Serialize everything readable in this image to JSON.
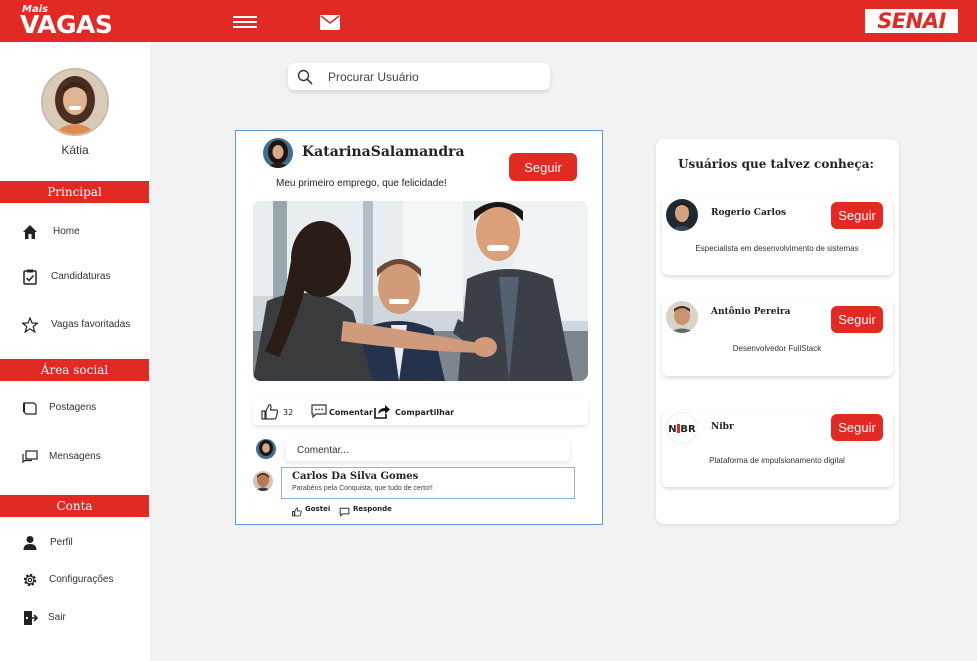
{
  "header": {
    "logo_small": "Mais",
    "logo_big": "VAGAS",
    "brand": "SENAI",
    "menu_icon": "hamburger-icon",
    "mail_icon": "mail-icon"
  },
  "sidebar": {
    "user_name": "Kátia",
    "sections": [
      "Principal",
      "Área social",
      "Conta"
    ],
    "principal": [
      {
        "label": "Home",
        "icon": "home-icon"
      },
      {
        "label": "Candidaturas",
        "icon": "clipboard-check-icon"
      },
      {
        "label": "Vagas favoritadas",
        "icon": "star-icon"
      }
    ],
    "social": [
      {
        "label": "Postagens",
        "icon": "postagens-icon"
      },
      {
        "label": "Mensagens",
        "icon": "messages-icon"
      }
    ],
    "conta": [
      {
        "label": "Perfil",
        "icon": "person-icon"
      },
      {
        "label": "Configurações",
        "icon": "gear-icon"
      },
      {
        "label": "Sair",
        "icon": "logout-icon"
      }
    ]
  },
  "search": {
    "placeholder": "Procurar Usuário"
  },
  "post": {
    "user": "KatarinaSalamandra",
    "follow_label": "Seguir",
    "text": "Meu primeiro emprego, que felicidade!",
    "likes": "32",
    "comment_label": "Comentar",
    "share_label": "Compartilhar",
    "comment_placeholder": "Comentar...",
    "comment": {
      "author": "Carlos Da Silva Gomes",
      "text": "Parabéns pela Conquista, que tudo de certo!!",
      "like_label": "Gostei",
      "reply_label": "Responde"
    }
  },
  "suggestions": {
    "title": "Usuários que talvez conheça:",
    "follow_label": "Seguir",
    "users": [
      {
        "name": "Rogerio Carlos",
        "desc": "Especialista em desenvolvimento de sistemas"
      },
      {
        "name": "Antônio Pereira",
        "desc": "Desenvolvedor FullStack"
      },
      {
        "name": "Nibr",
        "desc": "Plataforma de impulsionamento digital"
      }
    ]
  },
  "colors": {
    "brand_red": "#e02a23",
    "post_border": "#5a9bd8"
  }
}
